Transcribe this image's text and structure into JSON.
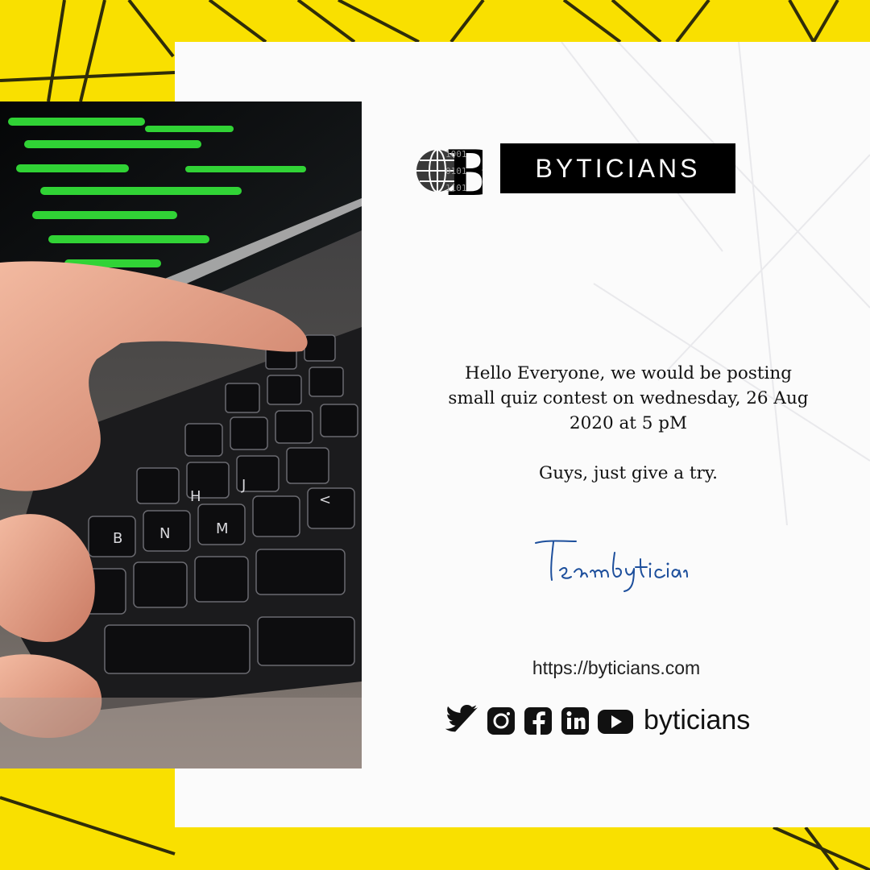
{
  "brand": {
    "logo_bits": [
      "1001",
      "0101",
      "1101"
    ],
    "logo_letter": "B",
    "name": "BYTICIANS"
  },
  "message": {
    "line1": "Hello Everyone, we would be posting",
    "line2": "small quiz contest on wednesday, 26 Aug",
    "line3": "2020 at 5 pM",
    "line4": "Guys, just give a try."
  },
  "signature": "Team byticians",
  "website": "https://byticians.com",
  "social": {
    "icons": [
      "twitter-icon",
      "instagram-icon",
      "facebook-icon",
      "linkedin-icon",
      "youtube-icon"
    ],
    "handle": "byticians"
  },
  "colors": {
    "accent_yellow": "#f9e000",
    "card_white": "#fbfbfb",
    "brand_black": "#000000",
    "signature_blue": "#1d4f9c",
    "code_green": "#3cff3c"
  }
}
